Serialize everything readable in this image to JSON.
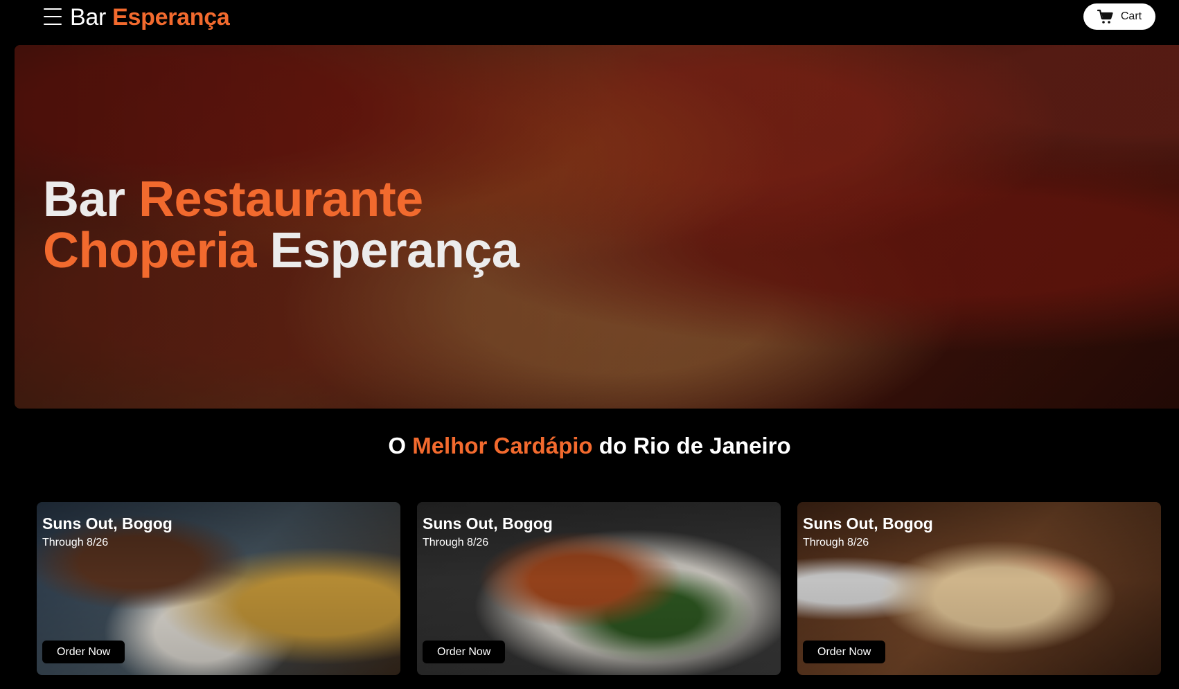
{
  "header": {
    "logo_part1": "Bar ",
    "logo_part2": "Esperança",
    "cart_label": "Cart"
  },
  "hero": {
    "line1_part1": "Bar ",
    "line1_part2": "Restaurante",
    "line2_part1": "Choperia",
    "line2_part2": " Esperança"
  },
  "section": {
    "part1": "O ",
    "part2": "Melhor Cardápio",
    "part3": " do Rio de Janeiro"
  },
  "cards": [
    {
      "title": "Suns Out, Bogog",
      "subtitle": "Through 8/26",
      "button": "Order Now"
    },
    {
      "title": "Suns Out, Bogog",
      "subtitle": "Through 8/26",
      "button": "Order Now"
    },
    {
      "title": "Suns Out, Bogog",
      "subtitle": "Through 8/26",
      "button": "Order Now"
    }
  ],
  "colors": {
    "accent": "#f26a2e",
    "background": "#000000"
  },
  "icons": {
    "menu": "hamburger-menu-icon",
    "cart": "shopping-cart-icon"
  }
}
